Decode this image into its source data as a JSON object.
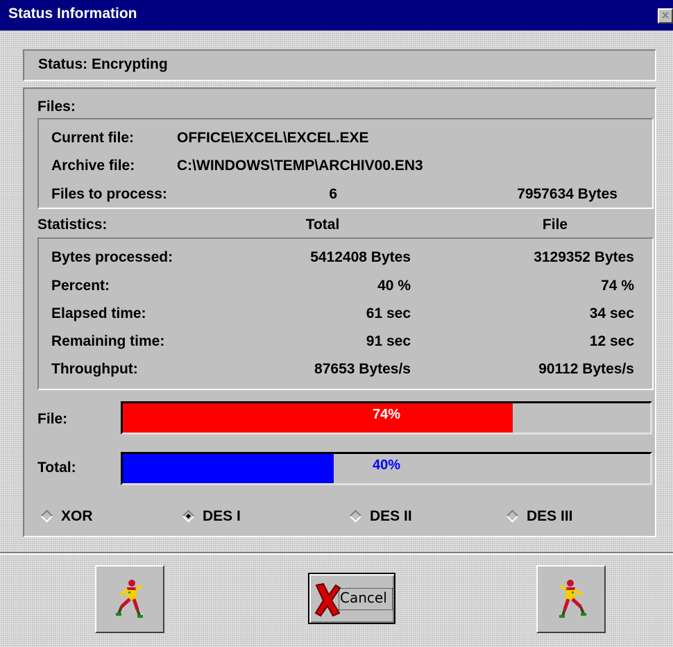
{
  "window": {
    "title": "Status Information",
    "close_glyph": "×"
  },
  "status": {
    "text": "Status:  Encrypting"
  },
  "files": {
    "label": "Files:",
    "current_file_label": "Current file:",
    "current_file_value": "OFFICE\\EXCEL\\EXCEL.EXE",
    "archive_file_label": "Archive file:",
    "archive_file_value": "C:\\WINDOWS\\TEMP\\ARCHIV00.EN3",
    "to_process_label": "Files to process:",
    "to_process_count": "6",
    "to_process_bytes": "7957634 Bytes"
  },
  "statistics": {
    "label": "Statistics:",
    "col_total": "Total",
    "col_file": "File",
    "rows": [
      {
        "label": "Bytes processed:",
        "total": "5412408 Bytes",
        "file": "3129352 Bytes"
      },
      {
        "label": "Percent:",
        "total": "40 %",
        "file": "74 %"
      },
      {
        "label": "Elapsed time:",
        "total": "61  sec",
        "file": "34  sec"
      },
      {
        "label": "Remaining time:",
        "total": "91  sec",
        "file": "12  sec"
      },
      {
        "label": "Throughput:",
        "total": "87653 Bytes/s",
        "file": "90112 Bytes/s"
      }
    ]
  },
  "progress": {
    "file": {
      "label": "File:",
      "text": "74%",
      "value": 0.74,
      "color": "#ff0000",
      "text_color": "#ffffff"
    },
    "total": {
      "label": "Total:",
      "text": "40%",
      "value": 0.4,
      "color": "#0000ff",
      "text_color": "#0000ff"
    }
  },
  "algorithms": [
    {
      "label": "XOR",
      "selected": false
    },
    {
      "label": "DES I",
      "selected": true
    },
    {
      "label": "DES II",
      "selected": false
    },
    {
      "label": "DES III",
      "selected": false
    }
  ],
  "buttons": {
    "left_icon": "running-man-icon",
    "cancel_label": "Cancel",
    "cancel_icon": "red-x-icon",
    "right_icon": "running-man-icon"
  }
}
